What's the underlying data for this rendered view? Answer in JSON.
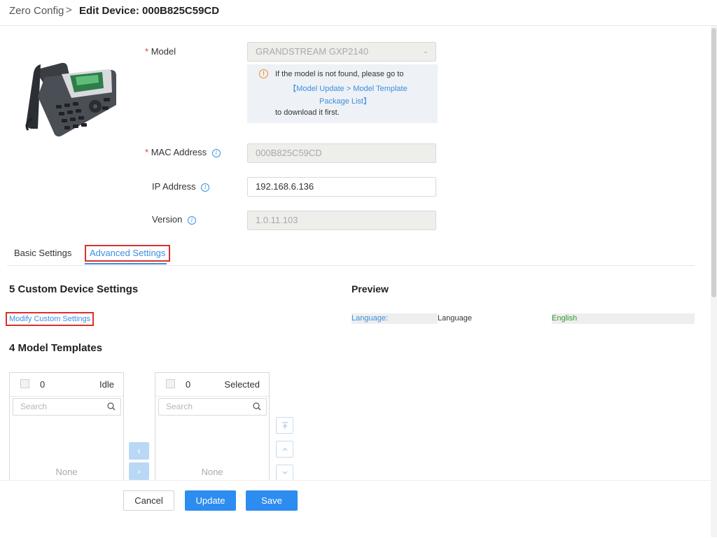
{
  "breadcrumb": {
    "parent": "Zero Config",
    "separator": ">",
    "title": "Edit Device: 000B825C59CD"
  },
  "form": {
    "model": {
      "label": "Model",
      "value": "GRANDSTREAM GXP2140"
    },
    "notice": {
      "line1": "If the model is not found, please go to",
      "link1": "【Model Update > Model Template",
      "link2": "Package List】",
      "line2": "to download it first."
    },
    "mac": {
      "label": "MAC Address",
      "value": "000B825C59CD"
    },
    "ip": {
      "label": "IP Address",
      "value": "192.168.6.136"
    },
    "version": {
      "label": "Version",
      "value": "1.0.11.103"
    }
  },
  "tabs": {
    "basic": "Basic Settings",
    "advanced": "Advanced Settings"
  },
  "custom": {
    "title": "5 Custom Device Settings",
    "modify": "Modify Custom Settings"
  },
  "preview": {
    "title": "Preview",
    "key": "Language:",
    "name": "Language",
    "value": "English"
  },
  "templates": {
    "title": "4 Model Templates",
    "idle": {
      "count": "0",
      "label": "Idle",
      "search_placeholder": "Search",
      "empty": "None"
    },
    "selected": {
      "count": "0",
      "label": "Selected",
      "search_placeholder": "Search",
      "empty": "None"
    }
  },
  "footer": {
    "cancel": "Cancel",
    "update": "Update",
    "save": "Save"
  },
  "colors": {
    "accent": "#2d8cf0",
    "link": "#3b8fe0",
    "highlight_box": "#d9312b",
    "preview_value": "#2e9a2e"
  }
}
